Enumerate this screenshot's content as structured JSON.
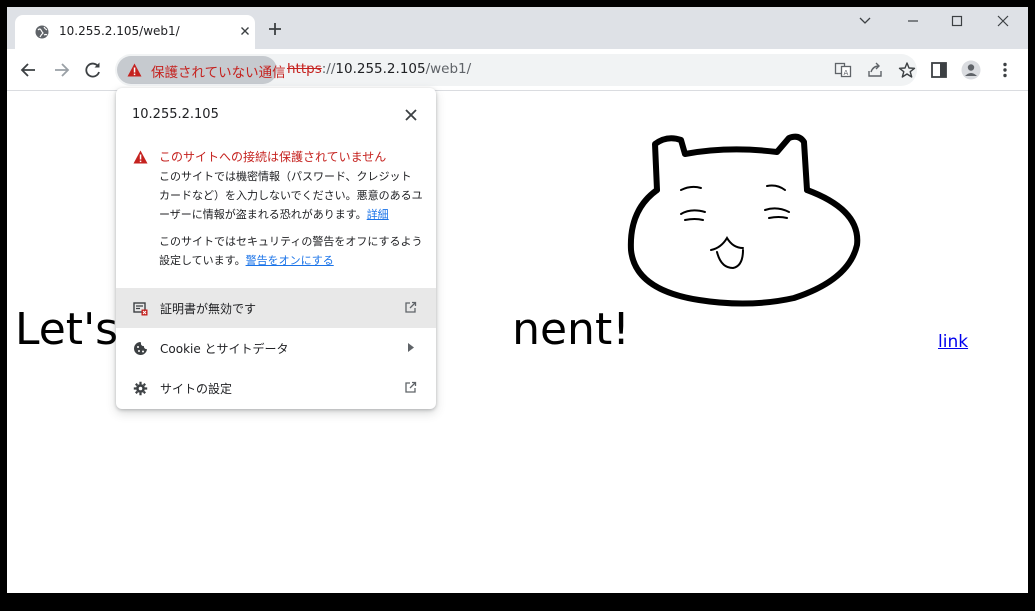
{
  "tab": {
    "title": "10.255.2.105/web1/",
    "icon": "globe-icon"
  },
  "omnibox": {
    "security_label": "保護されていない通信",
    "url_scheme": "https",
    "url_sep": "://",
    "url_host": "10.255.2.105",
    "url_path": "/web1/"
  },
  "popup": {
    "title": "10.255.2.105",
    "warning_title": "このサイトへの接続は保護されていません",
    "warning_body": "このサイトでは機密情報（パスワード、クレジット カードなど）を入力しないでください。悪意のあるユーザーに情報が盗まれる恐れがあります。",
    "warning_link": "詳細",
    "note_body": "このサイトではセキュリティの警告をオフにするよう設定しています。",
    "note_link": "警告をオンにする",
    "items": [
      {
        "label": "証明書が無効です",
        "icon": "certificate-invalid-icon",
        "end": "open-external-icon"
      },
      {
        "label": "Cookie とサイトデータ",
        "icon": "cookie-icon",
        "end": "chevron-right-icon"
      },
      {
        "label": "サイトの設定",
        "icon": "gear-icon",
        "end": "open-external-icon"
      }
    ]
  },
  "page": {
    "heading_left": "Let's",
    "heading_right": "nent!",
    "link": "link"
  },
  "colors": {
    "warning_red": "#c5221f",
    "link_blue": "#1a73e8",
    "tabstrip": "#dee1e6"
  }
}
